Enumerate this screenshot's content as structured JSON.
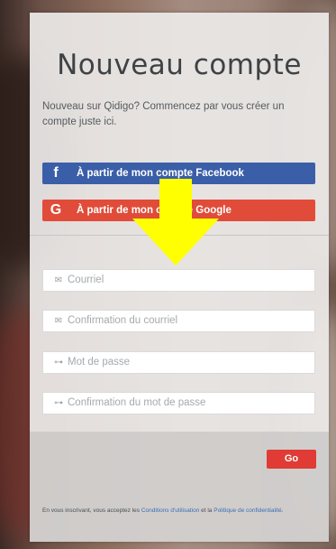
{
  "page": {
    "title": "Nouveau compte",
    "intro": "Nouveau sur Qidigo? Commencez par vous créer un compte juste ici."
  },
  "social": {
    "facebook_icon": "f",
    "facebook_label": "À partir de mon compte Facebook",
    "google_icon": "G",
    "google_label": "À partir de mon compte Google"
  },
  "form": {
    "email_placeholder": "Courriel",
    "email_confirm_placeholder": "Confirmation du courriel",
    "password_placeholder": "Mot de passe",
    "password_confirm_placeholder": "Confirmation du mot de passe",
    "submit_label": "Go"
  },
  "terms": {
    "prefix": "En vous inscrivant, vous acceptez les ",
    "conditions_link": "Conditions d'utilisation",
    "middle": " et la ",
    "policy_link": "Politique de confidentialité",
    "suffix": "."
  },
  "icons": {
    "envelope": "envelope-icon",
    "key": "key-icon",
    "arrow": "arrow-down-icon"
  },
  "colors": {
    "facebook": "#3b5ea8",
    "google": "#e04c39",
    "submit": "#e03b35",
    "arrow": "#ffff00",
    "link": "#3b6fb8"
  }
}
